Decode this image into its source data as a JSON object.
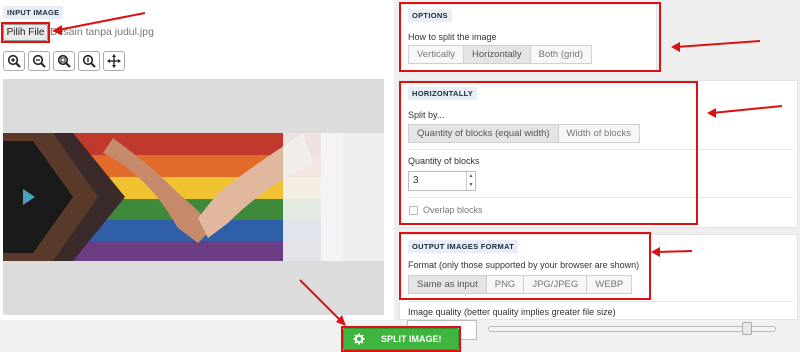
{
  "input_image": {
    "tag": "INPUT IMAGE",
    "file_button": "Pilih File",
    "file_name": "Desain tanpa judul.jpg",
    "zoom_tools": [
      "zoom-in-icon",
      "zoom-out-icon",
      "zoom-fit-icon",
      "zoom-reset-icon",
      "move-icon"
    ]
  },
  "options": {
    "tag": "OPTIONS",
    "how_label": "How to split the image",
    "modes": [
      "Vertically",
      "Horizontally",
      "Both (grid)"
    ],
    "selected_mode": "Horizontally"
  },
  "horizontally": {
    "tag": "HORIZONTALLY",
    "split_by_label": "Split by...",
    "split_by_options": [
      "Quantity of blocks (equal width)",
      "Width of blocks"
    ],
    "selected_split_by": "Quantity of blocks (equal width)",
    "quantity_label": "Quantity of blocks",
    "quantity_value": "3",
    "overlap_label": "Overlap blocks"
  },
  "output": {
    "tag": "OUTPUT IMAGES FORMAT",
    "format_label": "Format (only those supported by your browser are shown)",
    "formats": [
      "Same as input",
      "PNG",
      "JPG/JPEG",
      "WEBP"
    ],
    "selected_format": "Same as input",
    "quality_label": "Image quality (better quality implies greater file size)",
    "quality_level": 0.92
  },
  "split_button": "SPLIT IMAGE!",
  "colors": {
    "annotation_red": "#dd1111",
    "split_green": "#3fb43f"
  }
}
